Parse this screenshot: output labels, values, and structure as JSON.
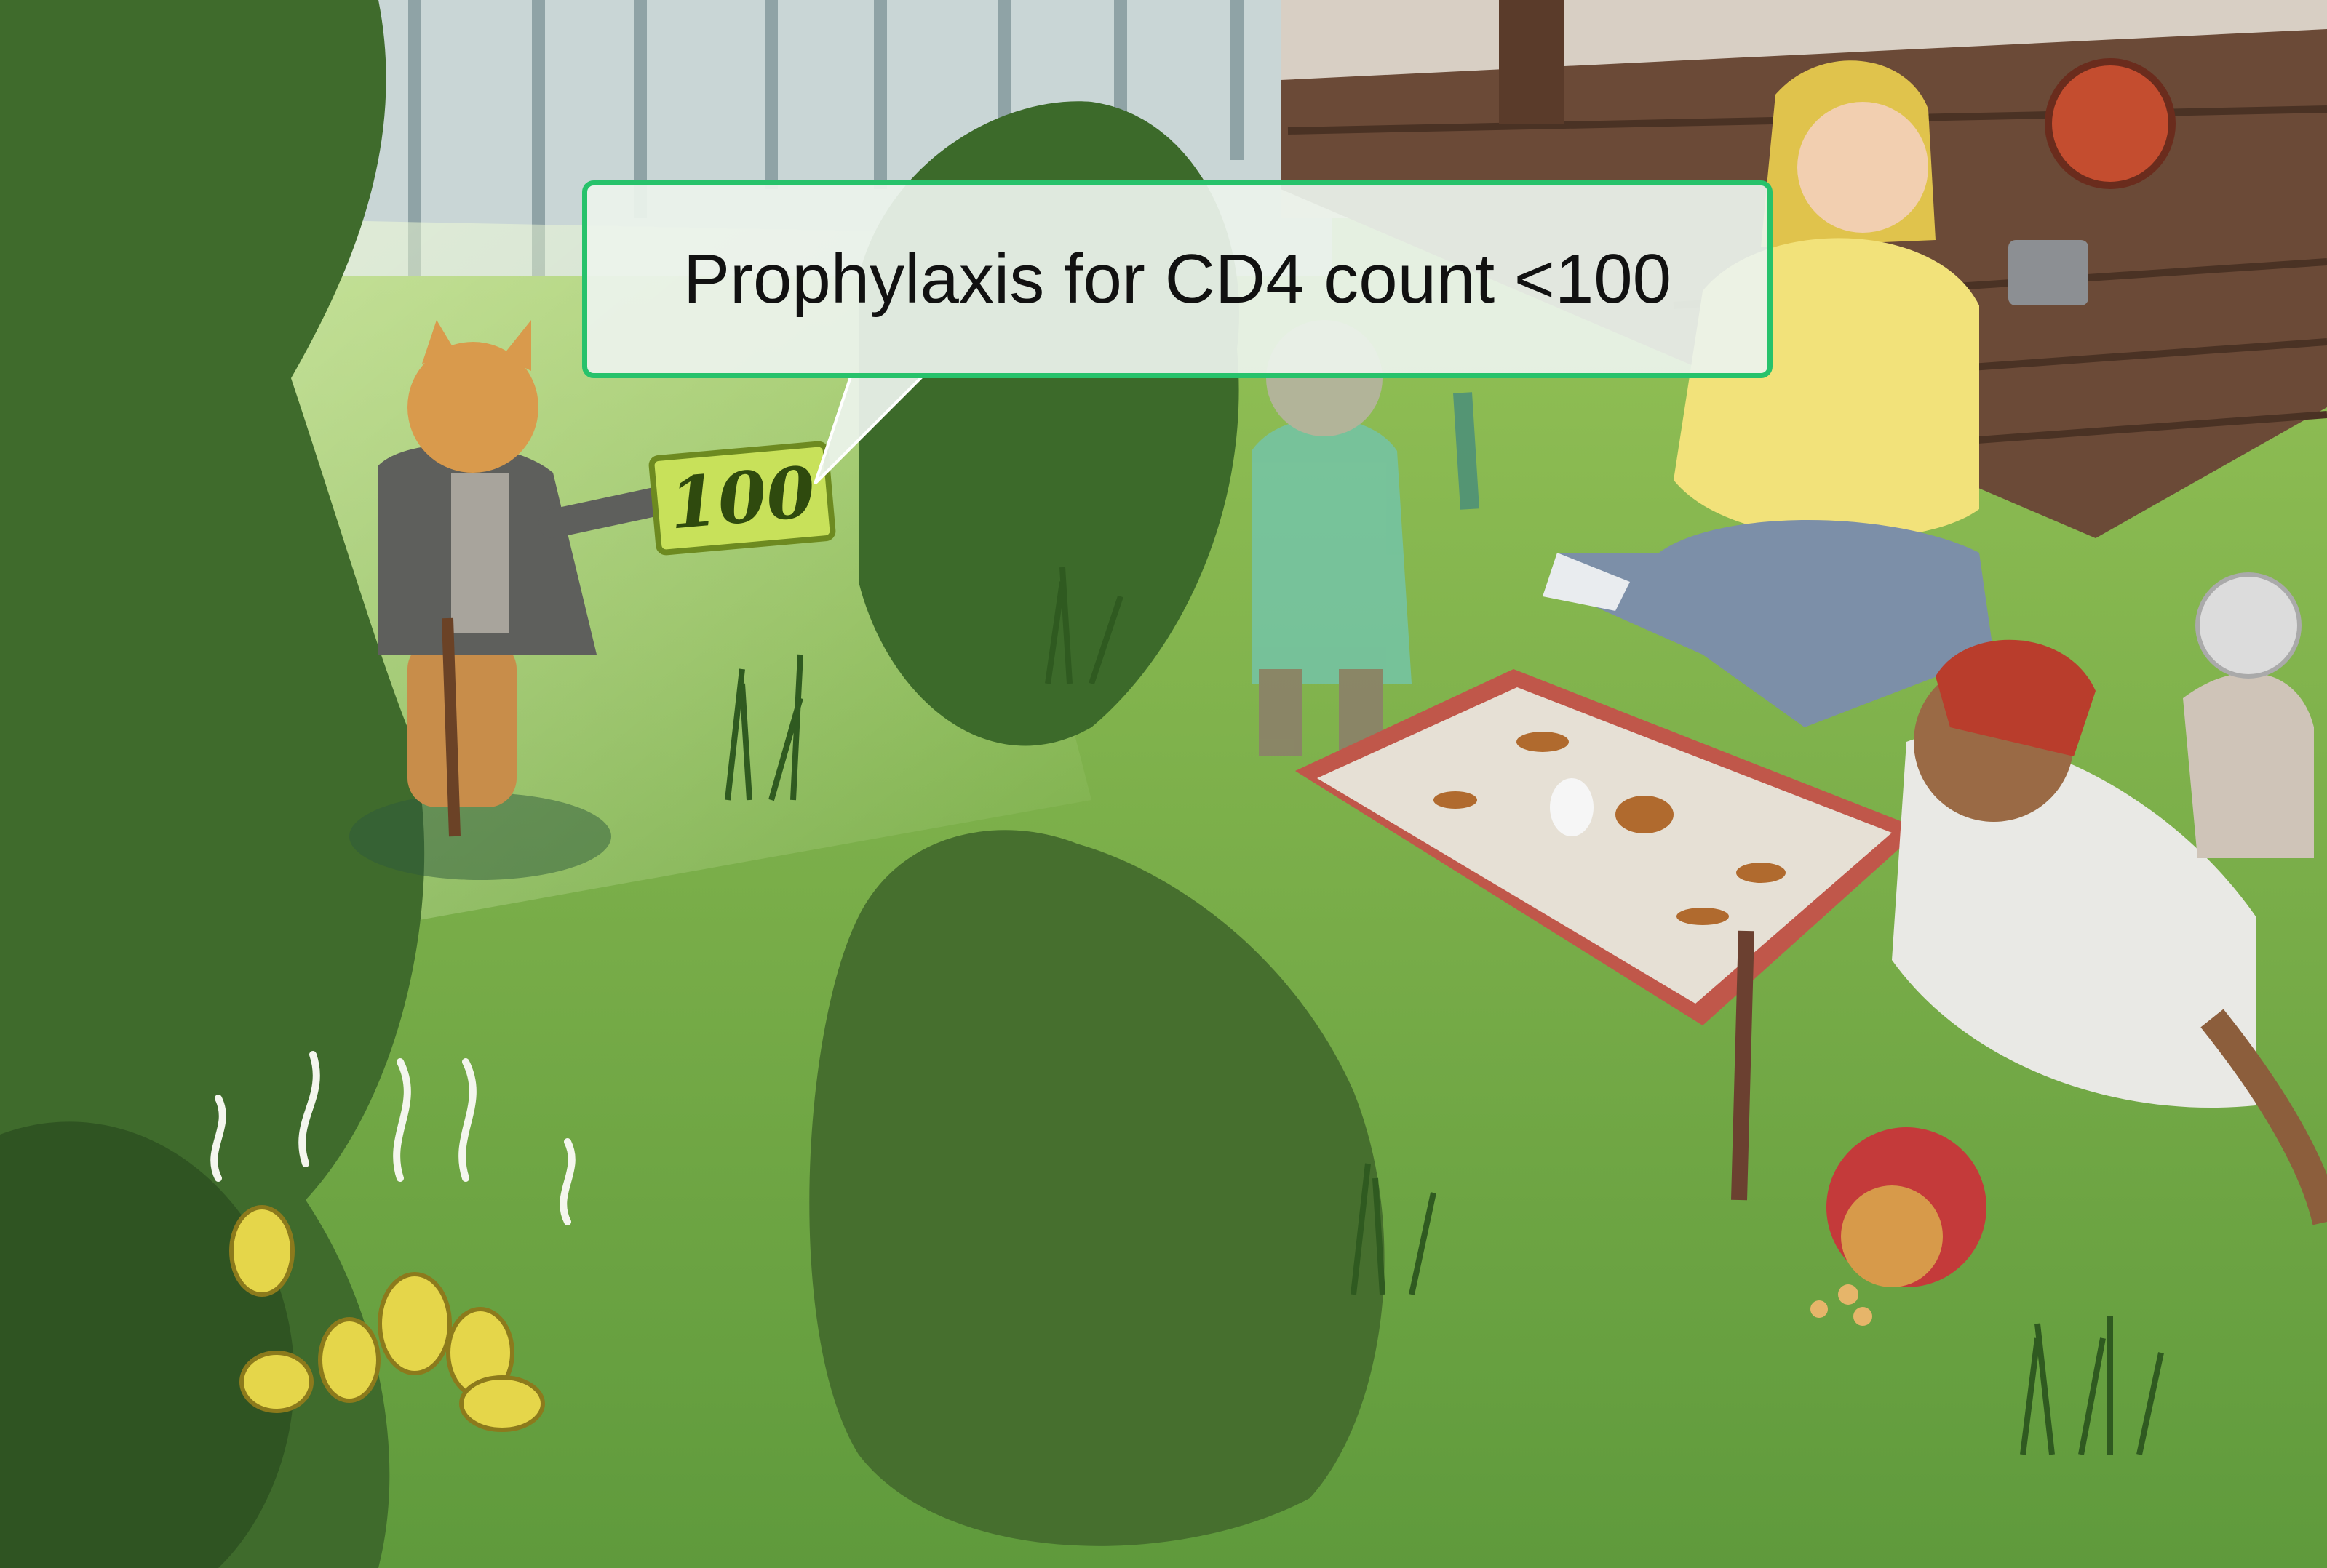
{
  "callout": {
    "text": "Prophylaxis for CD4 count <100"
  },
  "scene": {
    "bill_label": "100",
    "colors": {
      "callout_border": "#27c26b",
      "lawn": "#6aa43e",
      "bush": "#3f6b2c",
      "fence": "#c9d6d6",
      "porch": "#6b4a37",
      "litter_box": "#c0574a",
      "shirt": "#f2e27a",
      "jeans": "#7c8fa8",
      "bill": "#c8e15a"
    }
  }
}
